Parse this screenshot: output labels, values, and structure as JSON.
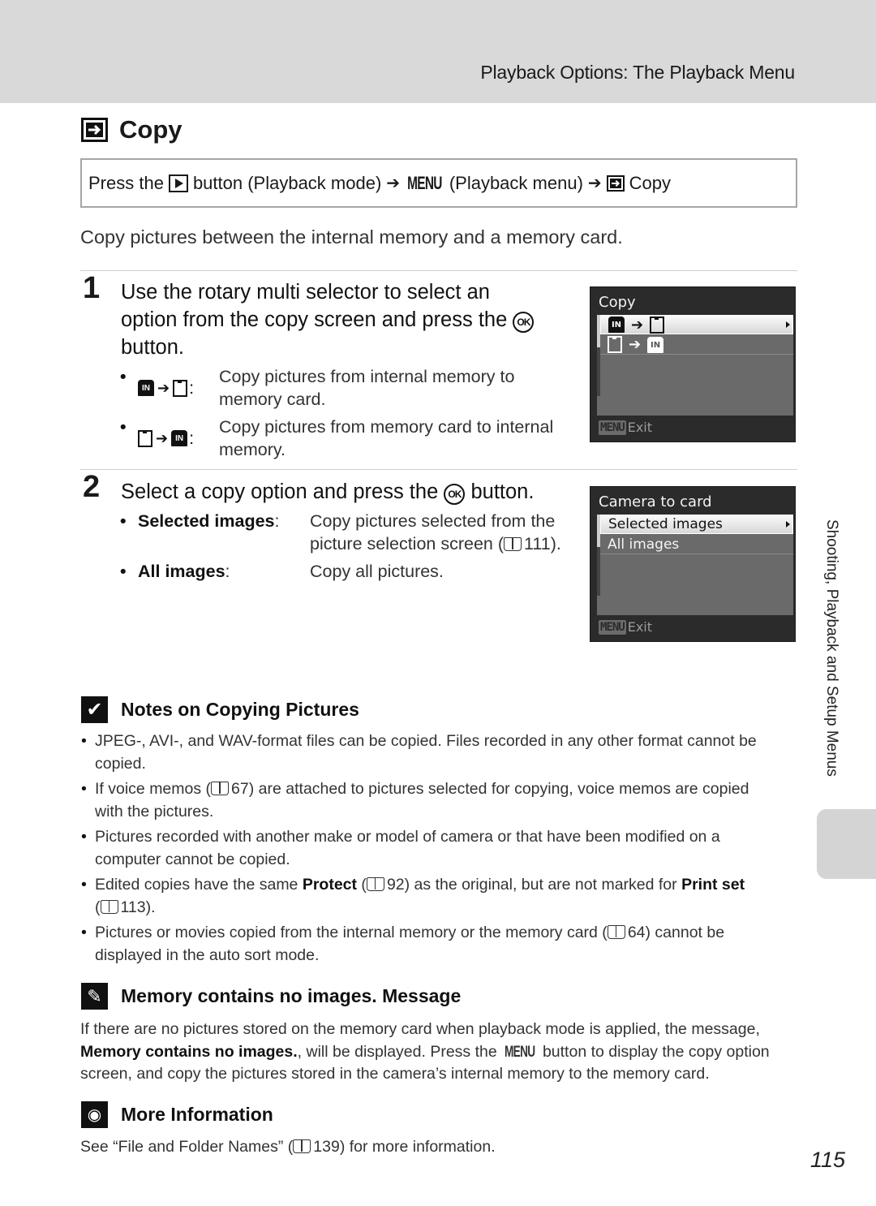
{
  "header": {
    "section_title": "Playback Options: The Playback Menu"
  },
  "page_title": {
    "icon": "copy-icon",
    "text": "Copy"
  },
  "nav_path": {
    "prefix": "Press the",
    "play_icon": "playback-button-icon",
    "part1": "button (Playback mode)",
    "arrow": "➔",
    "menu_label": "MENU",
    "part2": "(Playback menu)",
    "copy_icon": "copy-icon",
    "part3": "Copy"
  },
  "intro": "Copy pictures between the internal memory and a memory card.",
  "step1": {
    "number": "1",
    "line1": "Use the rotary multi selector to select an",
    "line2": "option from the copy screen and press the",
    "line3": "button.",
    "ok_label": "OK",
    "bullets": [
      {
        "key_from": "internal-memory-icon",
        "key_to": "memory-card-icon",
        "desc_line1": "Copy pictures from internal memory to",
        "desc_line2": "memory card."
      },
      {
        "key_from": "memory-card-icon",
        "key_to": "internal-memory-icon",
        "desc_line1": "Copy pictures from memory card to internal",
        "desc_line2": "memory."
      }
    ]
  },
  "screen1": {
    "title": "Copy",
    "items": [
      {
        "from": "IN",
        "to": "card",
        "selected": true
      },
      {
        "from": "card",
        "to": "IN",
        "selected": false
      }
    ],
    "footer_button": "MENU",
    "footer_label": "Exit",
    "in_label": "IN"
  },
  "step2": {
    "number": "2",
    "line1a": "Select a copy option and press the",
    "line1b": "button.",
    "ok_label": "OK",
    "bullets": [
      {
        "term": "Selected images",
        "colon": ":",
        "desc_line1": "Copy pictures selected from the",
        "desc_line2a": "picture selection screen (",
        "ref": "111",
        "desc_line2b": ")."
      },
      {
        "term": "All images",
        "colon": ":",
        "desc_line1": "Copy all pictures."
      }
    ]
  },
  "screen2": {
    "title": "Camera to card",
    "items": [
      {
        "label": "Selected images",
        "selected": true
      },
      {
        "label": "All images",
        "selected": false
      }
    ],
    "footer_button": "MENU",
    "footer_label": "Exit"
  },
  "notes": {
    "icon": "check-icon",
    "heading": "Notes on Copying Pictures",
    "items": [
      {
        "text_line1": "JPEG-, AVI-, and WAV-format files can be copied. Files recorded in any other format cannot be",
        "text_line2": "copied."
      },
      {
        "a": "If voice memos (",
        "ref": "67",
        "b": ") are attached to pictures selected for copying, voice memos are copied",
        "c": "with the pictures."
      },
      {
        "text_line1": "Pictures recorded with another make or model of camera or that have been modified on a",
        "text_line2": "computer cannot be copied."
      },
      {
        "a": "Edited copies have the same ",
        "bold1": "Protect",
        "b": " (",
        "ref1": "92",
        "c": ") as the original, but are not marked for ",
        "bold2": "Print set",
        "d": "(",
        "ref2": "113",
        "e": ")."
      },
      {
        "a": "Pictures or movies copied from the internal memory or the memory card (",
        "ref": "64",
        "b": ") cannot be",
        "c": "displayed in the auto sort mode."
      }
    ]
  },
  "memory_msg": {
    "icon": "pencil-icon",
    "heading": "Memory contains no images. Message",
    "p1": "If there are no pictures stored on the memory card when playback mode is applied, the message,",
    "bold": "Memory contains no images.",
    "p2": ", will be displayed. Press the ",
    "menu_label": "MENU",
    "p3": " button to display the copy option",
    "p4": "screen, and copy the pictures stored in the camera’s internal memory to the memory card."
  },
  "more_info": {
    "icon": "lightbulb-icon",
    "heading": "More Information",
    "a": "See “File and Folder Names” (",
    "ref": "139",
    "b": ") for more information."
  },
  "side_tab": {
    "label": "Shooting, Playback and Setup Menus"
  },
  "page_number": "115"
}
